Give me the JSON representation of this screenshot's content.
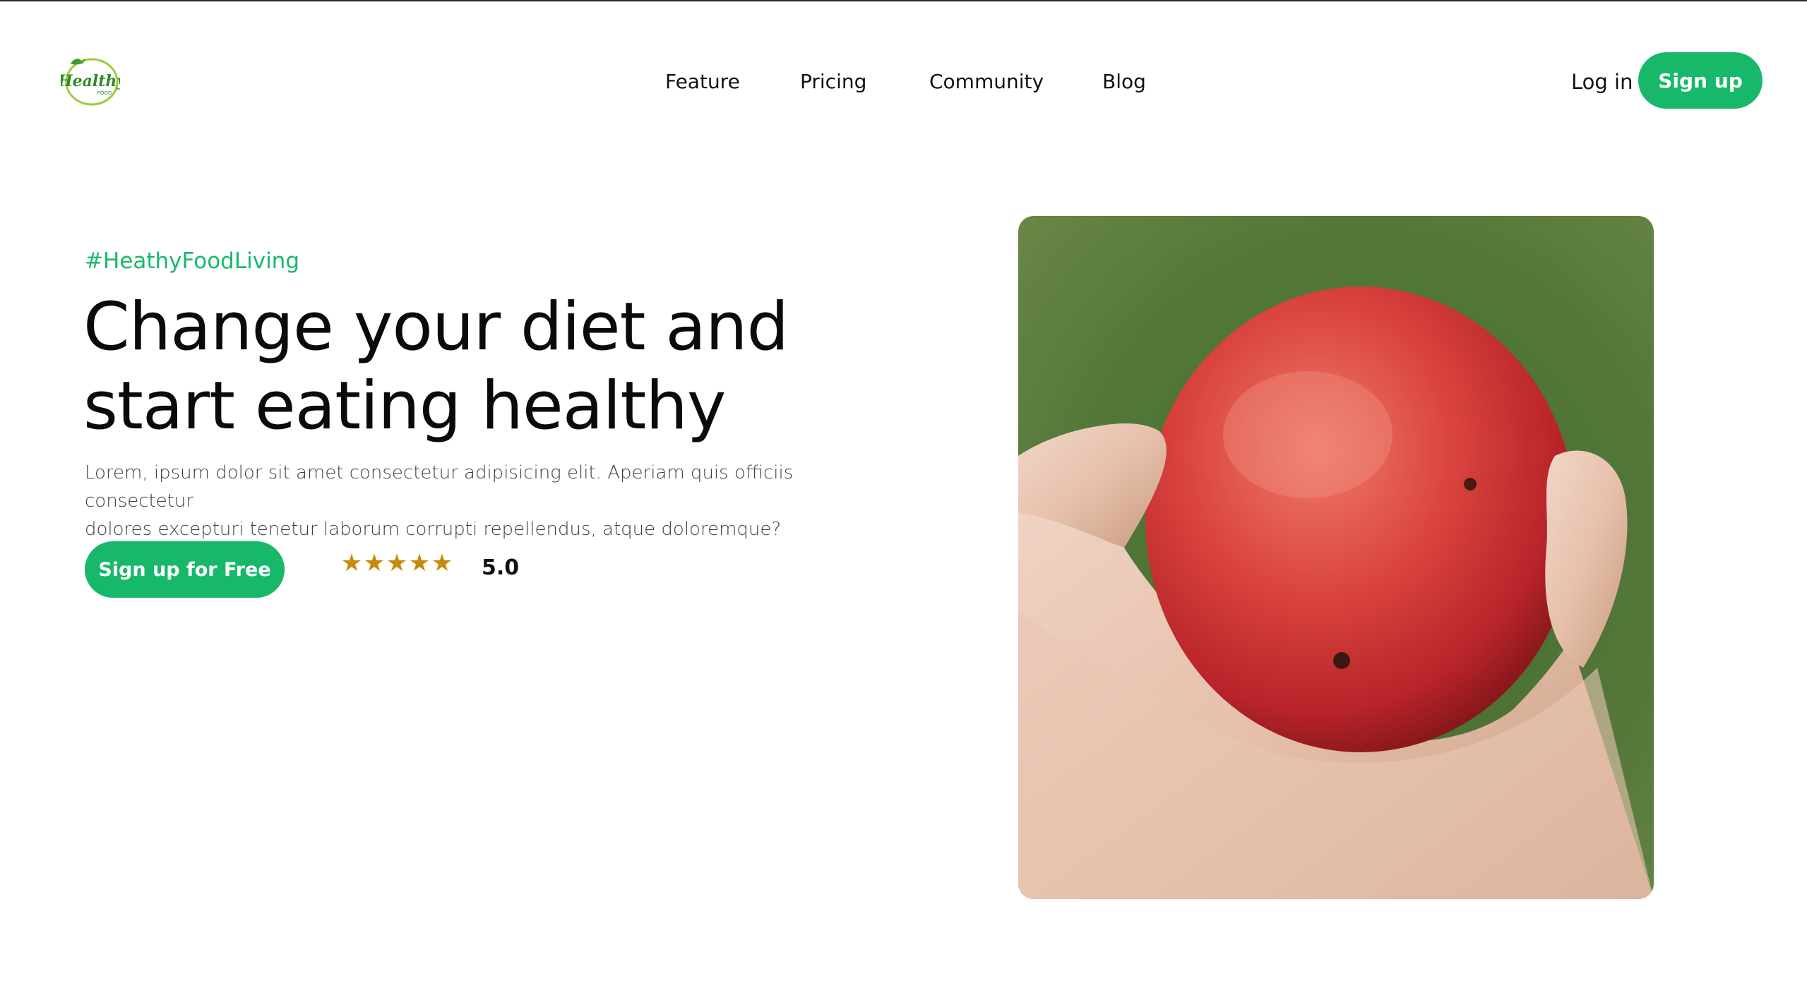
{
  "brand": {
    "logo_text": "Healthy",
    "logo_subtext": "FOOD",
    "accent_color": "#18b86a"
  },
  "nav": {
    "items": [
      {
        "label": "Feature"
      },
      {
        "label": "Pricing"
      },
      {
        "label": "Community"
      },
      {
        "label": "Blog"
      }
    ],
    "login_label": "Log in",
    "signup_label": "Sign up"
  },
  "hero": {
    "tag": "#HeathyFoodLiving",
    "headline_line1": "Change your diet and",
    "headline_line2": "start eating healthy",
    "lead_line1": "Lorem, ipsum dolor sit amet consectetur adipisicing elit. Aperiam quis officiis consectetur",
    "lead_line2": "dolores excepturi tenetur laborum corrupti repellendus, atque doloremque?",
    "cta_label": "Sign up for Free",
    "rating_stars": 5,
    "star_glyph": "★",
    "rating_value": "5.0",
    "star_color": "#c68a0c",
    "image_subject": "hand-holding-red-apple"
  }
}
